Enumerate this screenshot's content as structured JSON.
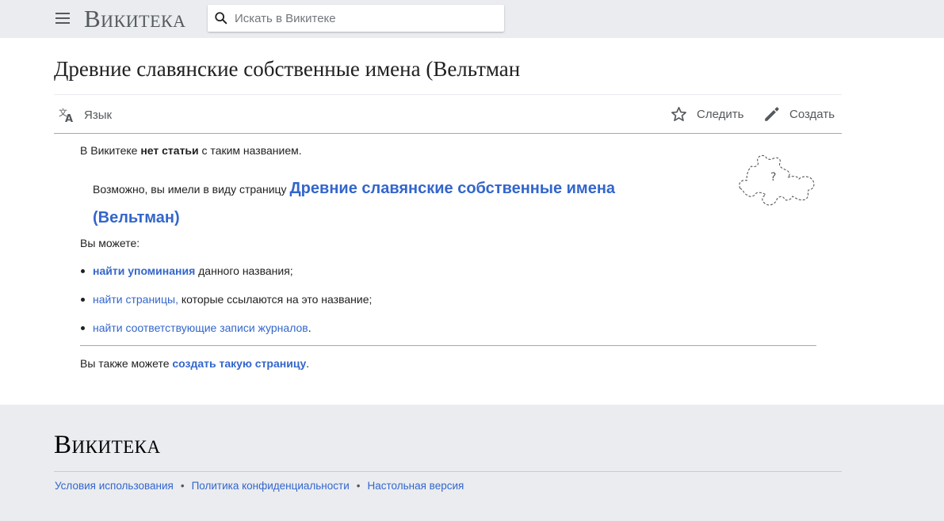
{
  "header": {
    "logo": "Викитека",
    "search": {
      "placeholder": "Искать в Викитеке",
      "value": ""
    }
  },
  "page": {
    "title": "Древние славянские собственные имена (Вельтман",
    "toolbar": {
      "language": "Язык",
      "watch": "Следить",
      "create": "Создать"
    }
  },
  "notice": {
    "intro_prefix": "В Викитеке ",
    "intro_bold": "нет статьи",
    "intro_suffix": " с таким названием.",
    "suggest_prefix": "Возможно, вы имели в виду страницу ",
    "suggest_link": "Древние славянские собственные имена (Вельтман)",
    "you_can": "Вы можете:",
    "items": [
      {
        "link": "найти упоминания",
        "text": " данного названия;"
      },
      {
        "link": "найти страницы,",
        "text": " которые ссылаются на это название;"
      },
      {
        "link": "найти соответствующие записи журналов",
        "text": "."
      }
    ],
    "also_prefix": "Вы также можете ",
    "also_link": "создать такую страницу",
    "also_suffix": "."
  },
  "footer": {
    "logo": "Викитека",
    "links": [
      "Условия использования",
      "Политика конфиденциальности",
      "Настольная версия"
    ],
    "separator": "•"
  },
  "icons": {
    "menu": "hamburger-icon",
    "search": "magnifier-icon",
    "language": "translate-icon",
    "watch": "star-outline-icon",
    "create": "pencil-icon",
    "puzzle": "puzzle-piece-icon"
  },
  "colors": {
    "link": "#3366cc",
    "text": "#202122",
    "muted": "#54595d",
    "chrome": "#eaecf0",
    "rule": "#a2a9b1"
  }
}
